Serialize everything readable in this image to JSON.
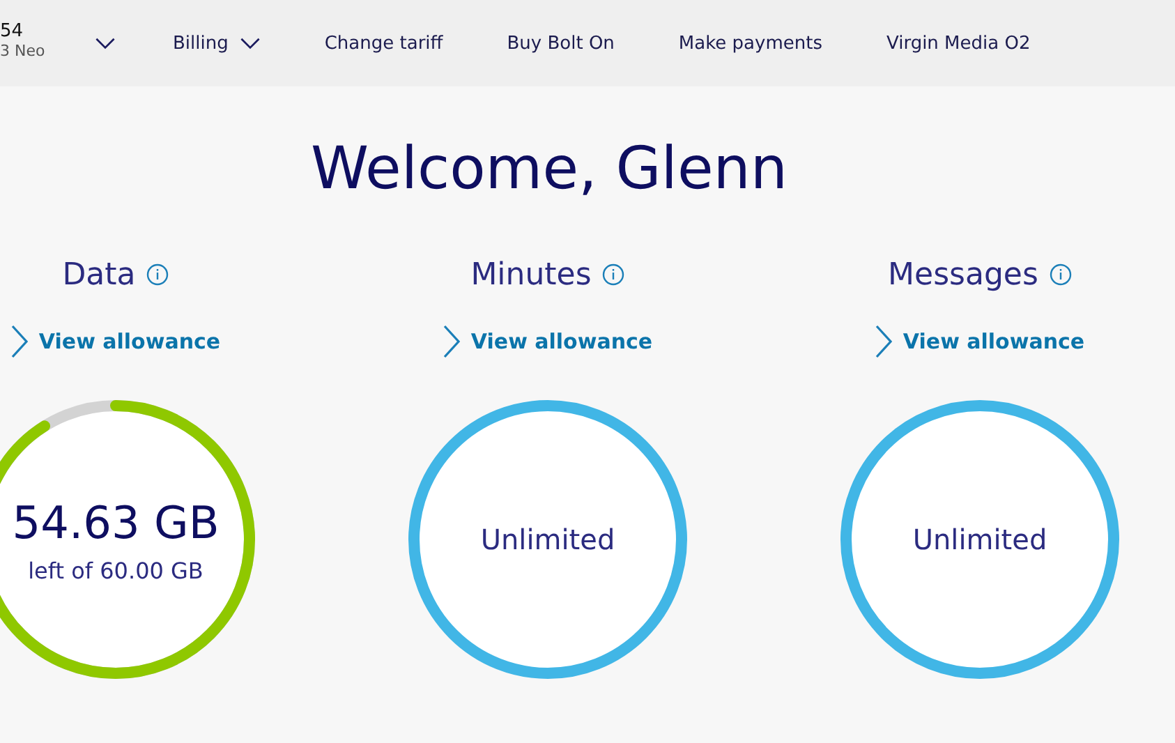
{
  "header": {
    "account": {
      "number": "54",
      "device": "3 Neo"
    },
    "nav": [
      {
        "label": "Billing",
        "dropdown": true
      },
      {
        "label": "Change tariff",
        "dropdown": false
      },
      {
        "label": "Buy Bolt On",
        "dropdown": false
      },
      {
        "label": "Make payments",
        "dropdown": false
      },
      {
        "label": "Virgin Media O2",
        "dropdown": false
      }
    ]
  },
  "greeting": "Welcome, Glenn",
  "allowances": [
    {
      "title": "Data",
      "link": "View allowance",
      "kind": "meter",
      "value": "54.63 GB",
      "caption": "left of 60.00 GB",
      "color": "#8fc800"
    },
    {
      "title": "Minutes",
      "link": "View allowance",
      "kind": "unlimited",
      "value": "Unlimited",
      "color": "#41b6e6"
    },
    {
      "title": "Messages",
      "link": "View allowance",
      "kind": "unlimited",
      "value": "Unlimited",
      "color": "#41b6e6"
    }
  ]
}
